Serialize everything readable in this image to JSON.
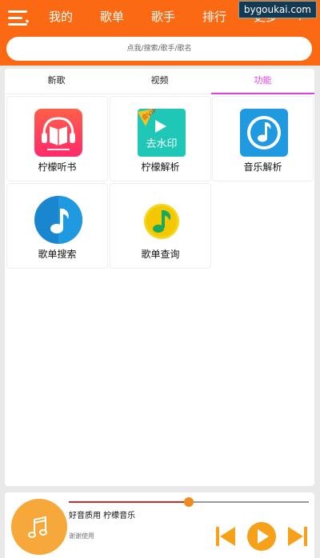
{
  "header": {
    "nav_items": [
      "我的",
      "歌单",
      "歌手",
      "排行",
      "更多"
    ],
    "watermark": "bygoukai.com",
    "search_placeholder": "点我/搜索/歌手/歌名"
  },
  "tabs": [
    {
      "label": "新歌",
      "active": false
    },
    {
      "label": "视频",
      "active": false
    },
    {
      "label": "功能",
      "active": true
    }
  ],
  "tiles": [
    {
      "label": "柠檬听书",
      "icon": "headphones-book-icon"
    },
    {
      "label": "柠檬解析",
      "icon": "vip-remove-watermark-icon",
      "badge": "会VIP",
      "badge_text": "去水印"
    },
    {
      "label": "音乐解析",
      "icon": "music-note-icon"
    },
    {
      "label": "歌单搜索",
      "icon": "music-note-icon"
    },
    {
      "label": "歌单查询",
      "icon": "qq-music-icon"
    }
  ],
  "player": {
    "title": "好音质用 柠檬音乐",
    "subtitle": "谢谢使用",
    "progress": 0.5
  },
  "colors": {
    "accent": "#fb6a12",
    "tab_active": "#e040e0",
    "control": "#f7a01a"
  }
}
